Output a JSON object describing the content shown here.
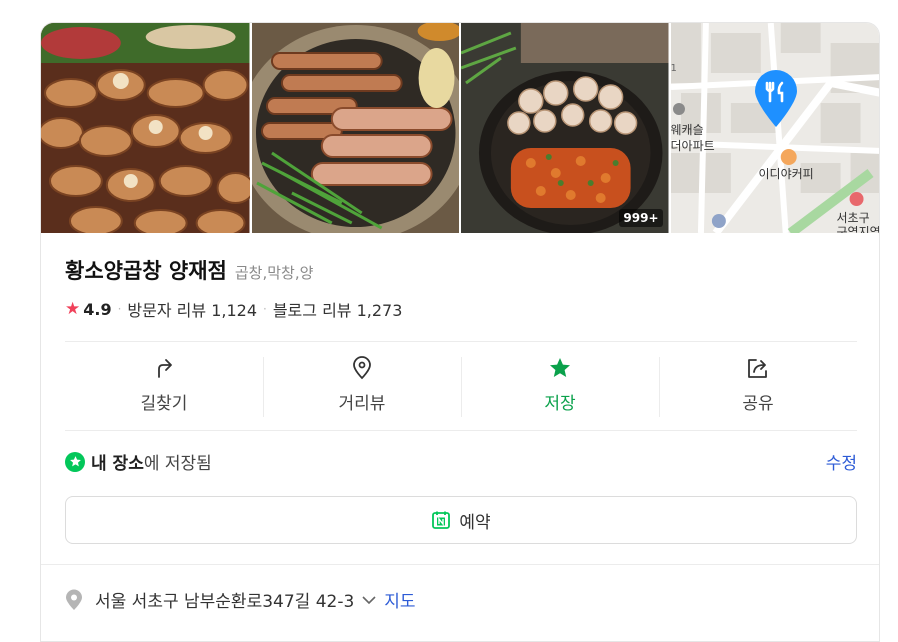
{
  "photos": {
    "count_badge": "999+"
  },
  "map": {
    "labels": [
      "웨캐슬",
      "더아파트",
      "이디야커피",
      "서초구",
      "구역지역",
      "1"
    ],
    "pin_color": "#1e90ff"
  },
  "place": {
    "name": "황소양곱창 양재점",
    "category": "곱창,막창,양"
  },
  "stats": {
    "rating": "4.9",
    "visitor_reviews": "방문자 리뷰 1,124",
    "blog_reviews": "블로그 리뷰 1,273",
    "star_color": "#f0415a"
  },
  "actions": [
    {
      "label": "길찾기",
      "icon": "directions-icon"
    },
    {
      "label": "거리뷰",
      "icon": "street-view-pin-icon"
    },
    {
      "label": "저장",
      "icon": "star-icon",
      "active": true
    },
    {
      "label": "공유",
      "icon": "share-icon"
    }
  ],
  "saved": {
    "bold": "내 장소",
    "rest": "에 저장됨",
    "edit_label": "수정",
    "accent": "#03c75a"
  },
  "reserve": {
    "label": "예약"
  },
  "address": {
    "text": "서울 서초구 남부순환로347길 42-3",
    "map_link": "지도"
  }
}
